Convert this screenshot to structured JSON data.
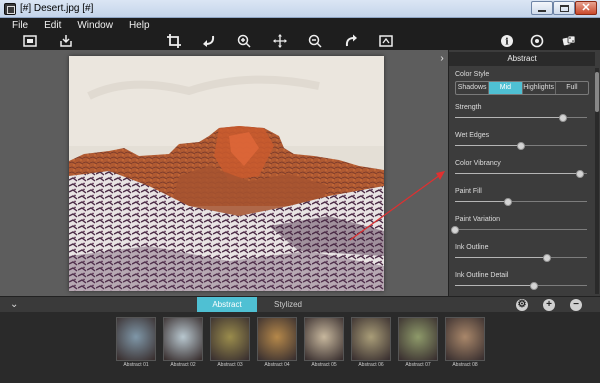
{
  "window": {
    "title": "[#] Desert.jpg [#]"
  },
  "menu": [
    "File",
    "Edit",
    "Window",
    "Help"
  ],
  "toolbar": {
    "left_icons": [
      "fit-screen-icon",
      "save-icon"
    ],
    "center_icons": [
      "crop-icon",
      "rotate-left-icon",
      "zoom-in-icon",
      "move-icon",
      "zoom-out-icon",
      "redo-icon",
      "compare-icon"
    ],
    "right_icons": [
      "info-icon",
      "settings-icon",
      "randomize-icon"
    ]
  },
  "panel": {
    "title": "Abstract",
    "color_style_label": "Color Style",
    "color_style_options": [
      "Shadows",
      "Mid",
      "Highlights",
      "Full"
    ],
    "color_style_selected": "Mid",
    "sliders": [
      {
        "label": "Strength",
        "value": 0.82
      },
      {
        "label": "Wet Edges",
        "value": 0.5
      },
      {
        "label": "Color Vibrancy",
        "value": 0.95
      },
      {
        "label": "Paint Fill",
        "value": 0.4
      },
      {
        "label": "Paint Variation",
        "value": 0.0
      },
      {
        "label": "Ink Outline",
        "value": 0.7
      },
      {
        "label": "Ink Outline Detail",
        "value": 0.6
      }
    ]
  },
  "tabs": {
    "abstract": "Abstract",
    "stylized": "Stylized"
  },
  "presets": [
    {
      "label": "Abstract 01",
      "tone": "#7f97a8"
    },
    {
      "label": "Abstract 02",
      "tone": "#b8c7cf"
    },
    {
      "label": "Abstract 03",
      "tone": "#9a8c4c"
    },
    {
      "label": "Abstract 04",
      "tone": "#b5884a"
    },
    {
      "label": "Abstract 05",
      "tone": "#c7b79d"
    },
    {
      "label": "Abstract 06",
      "tone": "#a99d78"
    },
    {
      "label": "Abstract 07",
      "tone": "#8e9a6a"
    },
    {
      "label": "Abstract 08",
      "tone": "#a9876a"
    }
  ],
  "colors": {
    "accent": "#4fc0d3",
    "arrow": "#e03030"
  }
}
